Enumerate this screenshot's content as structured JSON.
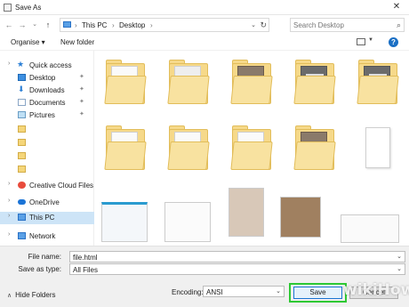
{
  "window": {
    "title": "Save As",
    "close_glyph": "✕"
  },
  "address": {
    "back_glyph": "←",
    "forward_glyph": "→",
    "dropdown_glyph": "⌄",
    "up_glyph": "↑",
    "crumbs": [
      "This PC",
      "Desktop"
    ],
    "separator": "›",
    "search_placeholder": "Search Desktop"
  },
  "toolbar": {
    "organise_label": "Organise ▾",
    "new_folder_label": "New folder",
    "help_label": "?"
  },
  "nav_pane": {
    "items": [
      {
        "label": "Quick access",
        "icon": "star-icon",
        "pinned": false
      },
      {
        "label": "Desktop",
        "icon": "desktop-icon",
        "pinned": true
      },
      {
        "label": "Downloads",
        "icon": "download-icon",
        "pinned": true
      },
      {
        "label": "Documents",
        "icon": "documents-icon",
        "pinned": true
      },
      {
        "label": "Pictures",
        "icon": "pictures-icon",
        "pinned": true
      },
      {
        "label": "",
        "icon": "folder-icon",
        "pinned": false
      },
      {
        "label": "",
        "icon": "folder-icon",
        "pinned": false
      },
      {
        "label": "",
        "icon": "folder-icon",
        "pinned": false
      },
      {
        "label": "",
        "icon": "folder-icon",
        "pinned": false
      },
      {
        "label": "Creative Cloud Files",
        "icon": "creative-cloud-icon",
        "pinned": false
      },
      {
        "label": "OneDrive",
        "icon": "onedrive-icon",
        "pinned": false
      },
      {
        "label": "This PC",
        "icon": "this-pc-icon",
        "pinned": false
      },
      {
        "label": "Network",
        "icon": "network-icon",
        "pinned": false
      }
    ],
    "pin_glyph": "📌",
    "selected": "This PC"
  },
  "bottom": {
    "file_name_label": "File name:",
    "file_name_value": "file.html",
    "save_as_type_label": "Save as type:",
    "save_as_type_value": "All Files",
    "encoding_label": "Encoding:",
    "encoding_value": "ANSI",
    "save_label": "Save",
    "cancel_label": "Cancel",
    "hide_folders_label": "Hide Folders"
  },
  "watermark": "wikiHow",
  "colors": {
    "accent": "#1a74d2",
    "selection": "#cde4f7",
    "highlight": "#2ec934",
    "folder": "#f6d98a"
  }
}
